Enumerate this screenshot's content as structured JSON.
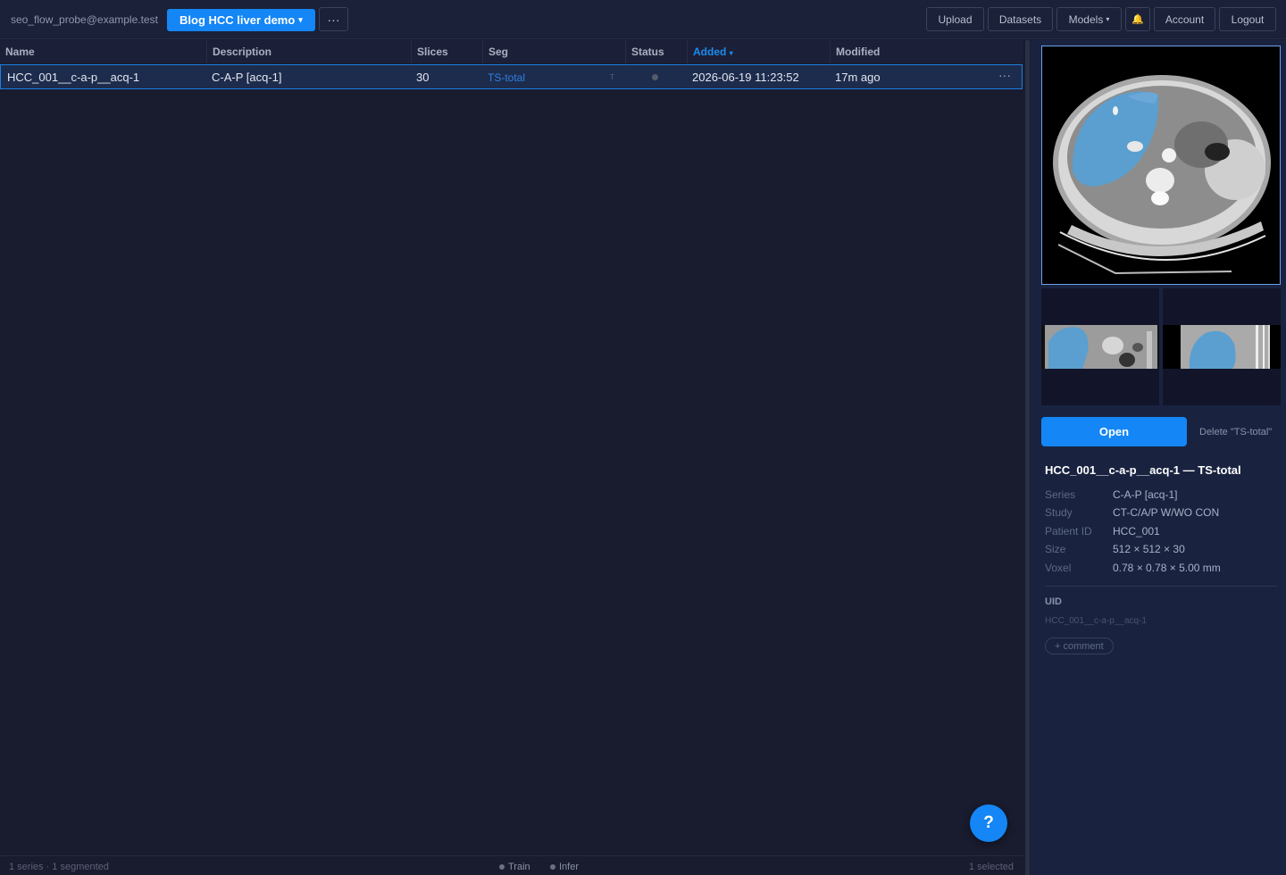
{
  "header": {
    "user_email": "seo_flow_probe@example.test",
    "project_label": "Blog HCC liver demo",
    "more_label": "···",
    "nav": {
      "upload": "Upload",
      "datasets": "Datasets",
      "models": "Models",
      "bell_glyph": "🔔",
      "account": "Account",
      "logout": "Logout"
    }
  },
  "table": {
    "columns": [
      "Name",
      "Description",
      "Slices",
      "Seg",
      "Status",
      "Added",
      "Modified"
    ],
    "sort_column": "Added",
    "rows": [
      {
        "name": "HCC_001__c-a-p__acq-1",
        "description": "C-A-P [acq-1]",
        "slices": "30",
        "seg": "TS-total",
        "seg_mark": "T",
        "added": "2026-06-19 11:23:52",
        "modified": "17m ago",
        "menu": "···"
      }
    ]
  },
  "footer": {
    "summary": "1 series · 1 segmented",
    "legend_train": "Train",
    "legend_infer": "Infer",
    "selected": "1 selected"
  },
  "help_label": "?",
  "panel": {
    "open_label": "Open",
    "delete_label": "Delete \"TS-total\"",
    "title": "HCC_001__c-a-p__acq-1 — TS-total",
    "details": [
      {
        "key": "Series",
        "value": "C-A-P [acq-1]"
      },
      {
        "key": "Study",
        "value": "CT-C/A/P W/WO CON"
      },
      {
        "key": "Patient ID",
        "value": "HCC_001"
      },
      {
        "key": "Size",
        "value": "512 × 512 × 30"
      },
      {
        "key": "Voxel",
        "value": "0.78 × 0.78 × 5.00 mm"
      }
    ],
    "uid_label": "UID",
    "uid_value": "HCC_001__c-a-p__acq-1",
    "comment_label": "+ comment"
  },
  "colors": {
    "accent": "#1486f5",
    "segmentation_overlay": "#5a9fd0",
    "background": "#191b2e"
  }
}
